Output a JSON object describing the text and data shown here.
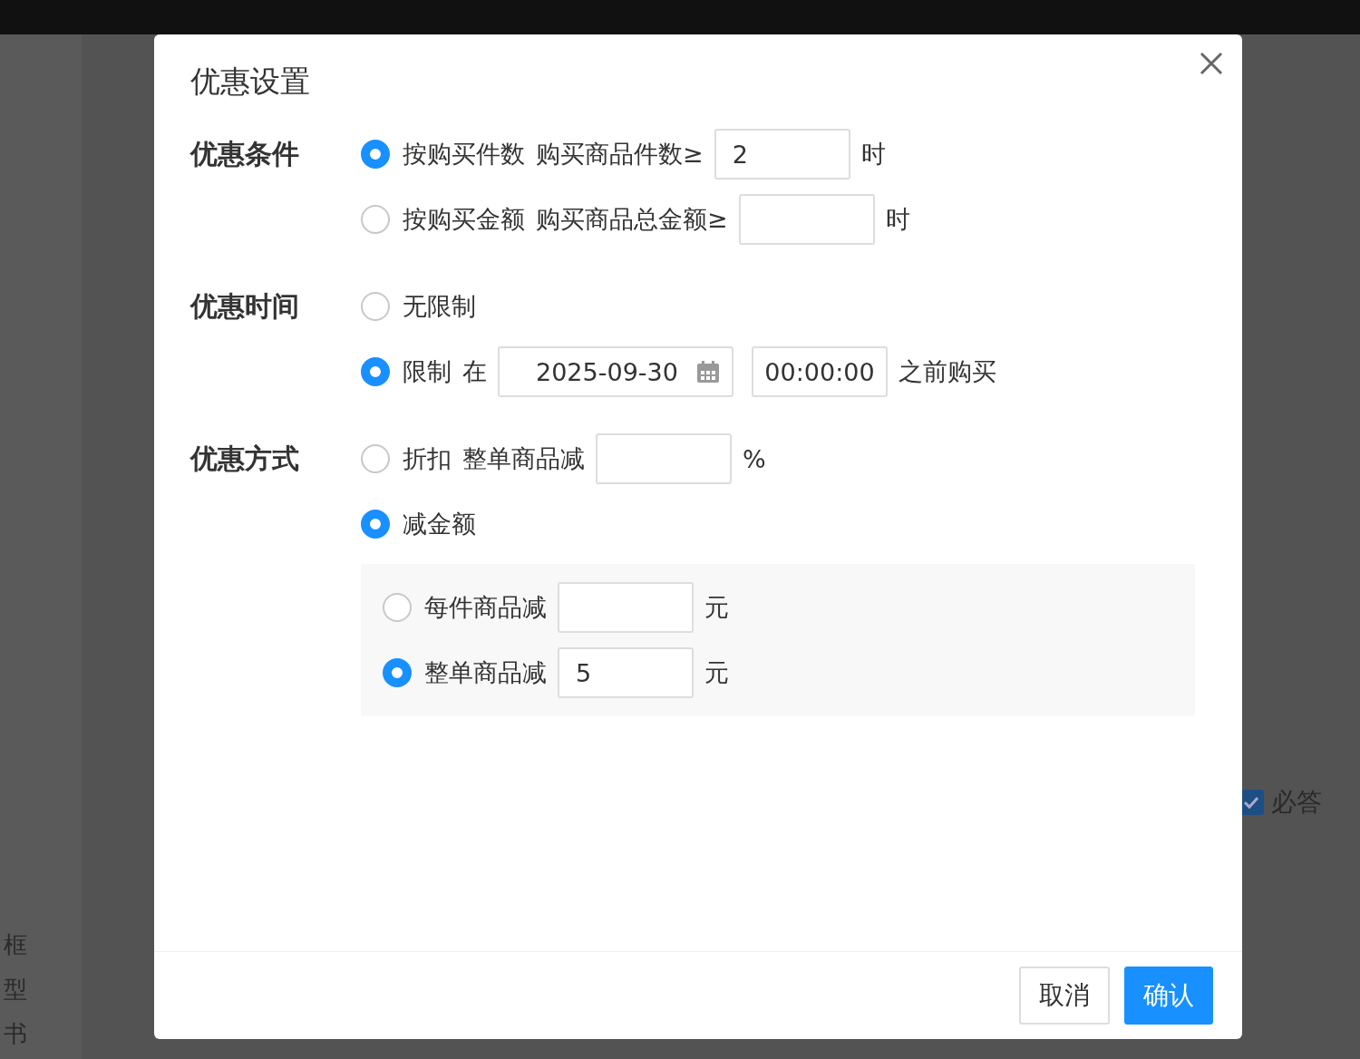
{
  "dialog": {
    "title": "优惠设置",
    "sections": [
      {
        "label": "优惠条件",
        "options": [
          {
            "selected": true,
            "parts": [
              {
                "kind": "text",
                "text": "按购买件数"
              },
              {
                "kind": "text",
                "text": "购买商品件数≥"
              },
              {
                "kind": "input",
                "value": "2"
              },
              {
                "kind": "text",
                "text": "时"
              }
            ]
          },
          {
            "selected": false,
            "parts": [
              {
                "kind": "text",
                "text": "按购买金额"
              },
              {
                "kind": "text",
                "text": "购买商品总金额≥"
              },
              {
                "kind": "input"
              },
              {
                "kind": "text",
                "text": "时"
              }
            ]
          }
        ]
      },
      {
        "label": "优惠时间",
        "options": [
          {
            "selected": false,
            "parts": [
              {
                "kind": "text",
                "text": "无限制"
              }
            ]
          },
          {
            "selected": true,
            "parts": [
              {
                "kind": "text",
                "text": "限制"
              },
              {
                "kind": "text",
                "text": "在"
              },
              {
                "kind": "date",
                "value": "2025-09-30"
              },
              {
                "kind": "time",
                "value": "00:00:00"
              },
              {
                "kind": "text",
                "text": "之前购买"
              }
            ]
          }
        ]
      },
      {
        "label": "优惠方式",
        "options": [
          {
            "selected": false,
            "parts": [
              {
                "kind": "text",
                "text": "折扣"
              },
              {
                "kind": "text",
                "text": "整单商品减"
              },
              {
                "kind": "input"
              },
              {
                "kind": "text",
                "text": "%"
              }
            ]
          },
          {
            "selected": true,
            "parts": [
              {
                "kind": "text",
                "text": "减金额"
              }
            ],
            "suboptions": [
              {
                "selected": false,
                "parts": [
                  {
                    "kind": "text",
                    "text": "每件商品减"
                  },
                  {
                    "kind": "input"
                  },
                  {
                    "kind": "text",
                    "text": "元"
                  }
                ]
              },
              {
                "selected": true,
                "parts": [
                  {
                    "kind": "text",
                    "text": "整单商品减"
                  },
                  {
                    "kind": "input",
                    "value": "5"
                  },
                  {
                    "kind": "text",
                    "text": "元"
                  }
                ]
              }
            ]
          }
        ]
      }
    ],
    "buttons": [
      {
        "kind": "secondary",
        "label": "取消"
      },
      {
        "kind": "primary",
        "label": "确认"
      }
    ]
  },
  "background": {
    "sidebar_items": [
      "框",
      "型",
      "书"
    ],
    "required_checkbox": {
      "label": "必答",
      "checked": true
    }
  }
}
